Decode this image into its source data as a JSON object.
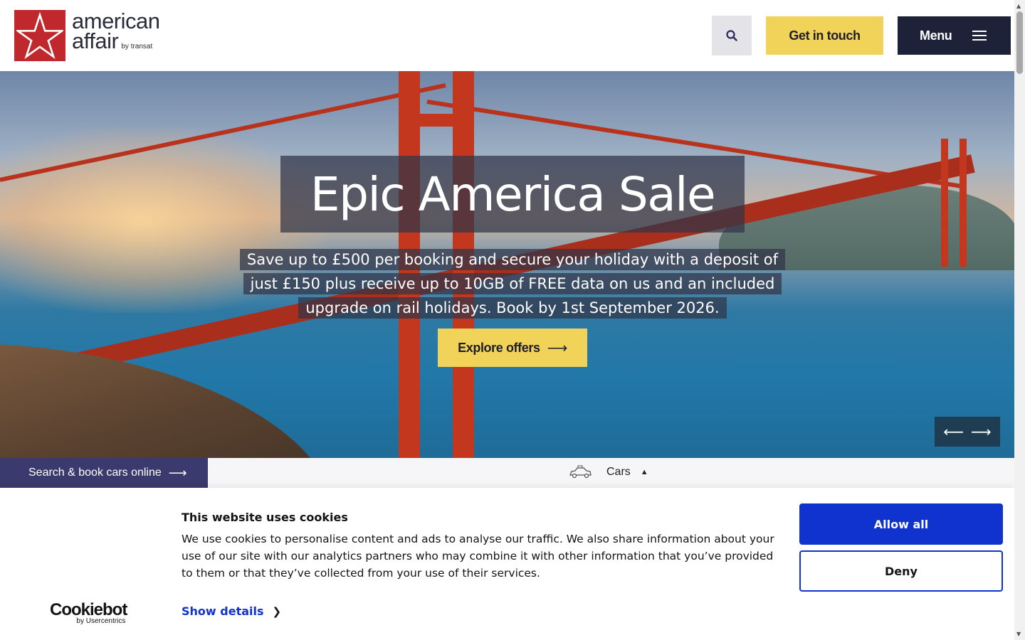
{
  "header": {
    "logo_line1": "american",
    "logo_line2": "affair",
    "logo_byline": "by transat",
    "search_icon": "search-icon",
    "contact_label": "Get in touch",
    "menu_label": "Menu",
    "menu_icon": "hamburger-icon",
    "colors": {
      "brand_red": "#c0282e",
      "accent_yellow": "#f2d35a",
      "navy": "#1e2238"
    }
  },
  "hero": {
    "headline": "Epic America Sale",
    "subline": "Save up to £500 per booking and secure your holiday with a deposit of just £150 plus receive up to 10GB of FREE data on us and an included upgrade on rail holidays. Book by 1st September 2026.",
    "cta_label": "Explore offers",
    "cta_arrow": "⟶",
    "prev_arrow": "⟵",
    "next_arrow": "⟶"
  },
  "search_bar": {
    "tab_label": "Search & book cars online",
    "tab_arrow": "⟶",
    "product_label": "Cars",
    "product_icon": "car-icon",
    "caret": "▲"
  },
  "cookie_banner": {
    "title": "This website uses cookies",
    "text": "We use cookies to personalise content and ads to analyse our traffic. We also share information about your use of our site with our analytics partners who may combine it with other information that you’ve provided to them or that they’ve collected from your use of their services.",
    "details_label": "Show details",
    "details_chevron": "❯",
    "brand_name": "Cookiebot",
    "brand_byline": "by Usercentrics",
    "allow_label": "Allow all",
    "deny_label": "Deny",
    "colors": {
      "primary_blue": "#1032cf"
    }
  }
}
